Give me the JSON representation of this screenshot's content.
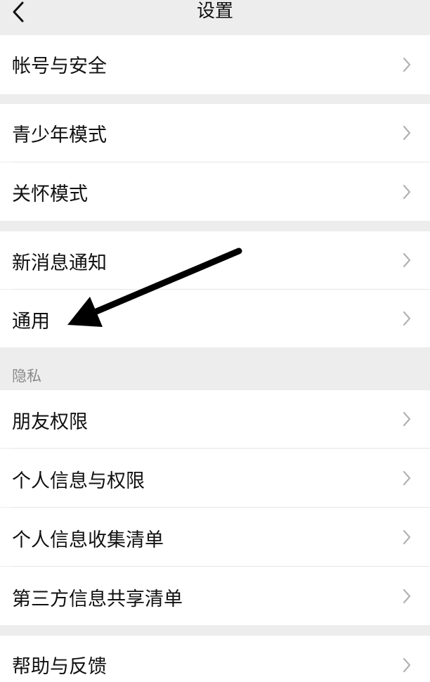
{
  "nav": {
    "title": "设置",
    "back_icon": "chevron-left-icon"
  },
  "groups": [
    {
      "items": [
        "帐号与安全"
      ]
    },
    {
      "items": [
        "青少年模式",
        "关怀模式"
      ]
    },
    {
      "items": [
        "新消息通知",
        "通用"
      ]
    },
    {
      "header": "隐私",
      "items": [
        "朋友权限",
        "个人信息与权限",
        "个人信息收集清单",
        "第三方信息共享清单"
      ]
    },
    {
      "items": [
        "帮助与反馈"
      ]
    }
  ],
  "icons": {
    "row_chevron": "chevron-right-icon",
    "annotation": "annotation-arrow-icon"
  },
  "colors": {
    "background": "#ededed",
    "card": "#ffffff",
    "text": "#111111",
    "secondary_text": "#8a8a8a",
    "chevron": "#b2b2b2",
    "annotation_arrow": "#000000"
  }
}
